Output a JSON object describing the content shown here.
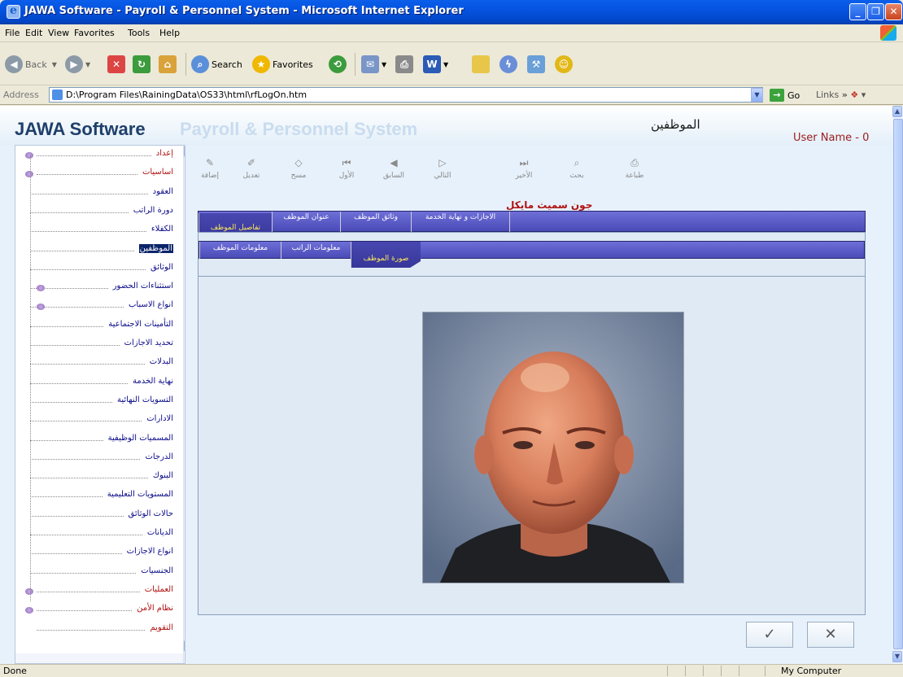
{
  "window": {
    "title": "JAWA Software - Payroll & Personnel System - Microsoft Internet Explorer"
  },
  "menu": [
    "File",
    "Edit",
    "View",
    "Favorites",
    "Tools",
    "Help"
  ],
  "toolbar": {
    "back": "Back",
    "search": "Search",
    "favorites": "Favorites"
  },
  "address": {
    "label": "Address",
    "value": "D:\\Program Files\\RainingData\\OS33\\html\\rfLogOn.htm",
    "go": "Go",
    "links": "Links"
  },
  "header": {
    "brand_bold": "JAWA Software",
    "brand_light": "Payroll & Personnel System",
    "role": "الموظفين"
  },
  "user": {
    "label": "User Name - 0"
  },
  "actions": [
    "إضافة",
    "تعديل",
    "مسح",
    "الأول",
    "السابق",
    "التالي",
    "الأخير",
    "بحث",
    "طباعة"
  ],
  "employee": {
    "name": "جون سميث مايكل"
  },
  "tabs_main": [
    "تفاصيل الموظف",
    "عنوان الموظف",
    "وثائق الموظف",
    "الاجازات و نهاية الخدمة"
  ],
  "tabs_sub": [
    "معلومات الموظف",
    "معلومات الراتب",
    "صورة الموظف"
  ],
  "tree": [
    {
      "label": "إعداد",
      "color": "#b01010"
    },
    {
      "label": "اساسيات",
      "color": "#b01010"
    },
    {
      "label": "العقود",
      "color": "#0a0a8a"
    },
    {
      "label": "دورة الراتب",
      "color": "#0a0a8a"
    },
    {
      "label": "الكفلاء",
      "color": "#0a0a8a"
    },
    {
      "label": "الموظفين",
      "color": "#0a0a8a",
      "selected": true
    },
    {
      "label": "الوثائق",
      "color": "#0a0a8a"
    },
    {
      "label": "استثناءات الحضور",
      "color": "#0a0a8a"
    },
    {
      "label": "انواع الاسباب",
      "color": "#0a0a8a"
    },
    {
      "label": "التأمينات الاجتماعية",
      "color": "#0a0a8a"
    },
    {
      "label": "تحديد الاجازات",
      "color": "#0a0a8a"
    },
    {
      "label": "البدلات",
      "color": "#0a0a8a"
    },
    {
      "label": "نهاية الخدمة",
      "color": "#0a0a8a"
    },
    {
      "label": "التسويات النهائية",
      "color": "#0a0a8a"
    },
    {
      "label": "الادارات",
      "color": "#0a0a8a"
    },
    {
      "label": "المسميات الوظيفية",
      "color": "#0a0a8a"
    },
    {
      "label": "الدرجات",
      "color": "#0a0a8a"
    },
    {
      "label": "البنوك",
      "color": "#0a0a8a"
    },
    {
      "label": "المستويات التعليمية",
      "color": "#0a0a8a"
    },
    {
      "label": "حالات الوثائق",
      "color": "#0a0a8a"
    },
    {
      "label": "الديانات",
      "color": "#0a0a8a"
    },
    {
      "label": "انواع الاجازات",
      "color": "#0a0a8a"
    },
    {
      "label": "الجنسيات",
      "color": "#0a0a8a"
    },
    {
      "label": "العمليات",
      "color": "#b01010"
    },
    {
      "label": "نظام الأمن",
      "color": "#b01010"
    },
    {
      "label": "التقويم",
      "color": "#b01010"
    }
  ],
  "buttons": {
    "ok": "✓",
    "cancel": "✕"
  },
  "status": {
    "left": "Done",
    "right": "My Computer"
  }
}
